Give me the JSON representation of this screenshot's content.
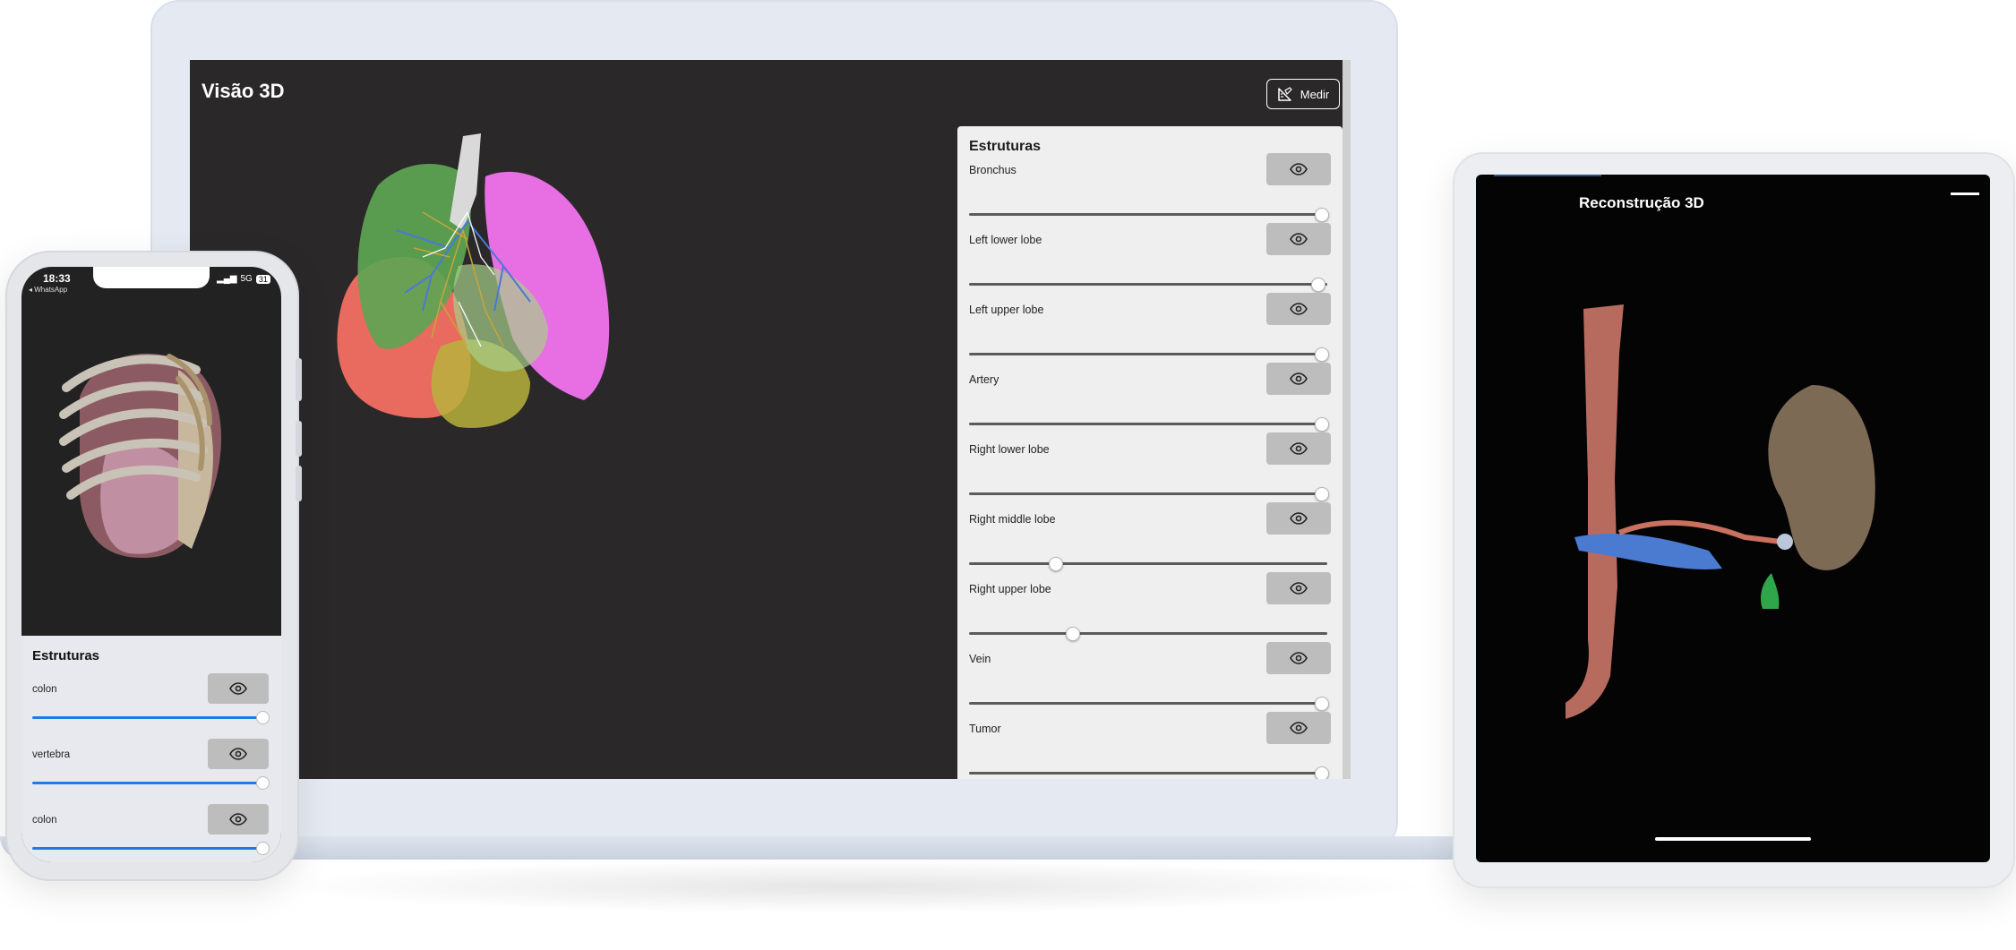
{
  "laptop": {
    "title": "Visão 3D",
    "medir_label": "Medir",
    "panel_title": "Estruturas",
    "structures": [
      {
        "label": "Bronchus",
        "value": 1.0
      },
      {
        "label": "Left lower lobe",
        "value": 0.99
      },
      {
        "label": "Left upper lobe",
        "value": 1.0
      },
      {
        "label": "Artery",
        "value": 1.0
      },
      {
        "label": "Right lower lobe",
        "value": 1.0
      },
      {
        "label": "Right middle lobe",
        "value": 0.23
      },
      {
        "label": "Right upper lobe",
        "value": 0.28
      },
      {
        "label": "Vein",
        "value": 1.0
      },
      {
        "label": "Tumor",
        "value": 1.0
      }
    ]
  },
  "phone": {
    "time": "18:33",
    "network": "5G",
    "battery": "31",
    "back_label": "◂ WhatsApp",
    "panel_title": "Estruturas",
    "structures": [
      {
        "label": "colon",
        "value": 1.0
      },
      {
        "label": "vertebra",
        "value": 1.0
      },
      {
        "label": "colon",
        "value": 1.0
      }
    ]
  },
  "tablet": {
    "title": "Reconstrução 3D"
  },
  "icons": {
    "eye": "eye-icon",
    "ruler": "ruler-icon",
    "menu": "menu-icon"
  },
  "colors": {
    "screen_bg": "#2a2829",
    "panel_bg": "#efefef",
    "eye_btn": "#bdbdbd",
    "phone_slider": "#1e7be6",
    "tablet_bg": "#040404"
  }
}
